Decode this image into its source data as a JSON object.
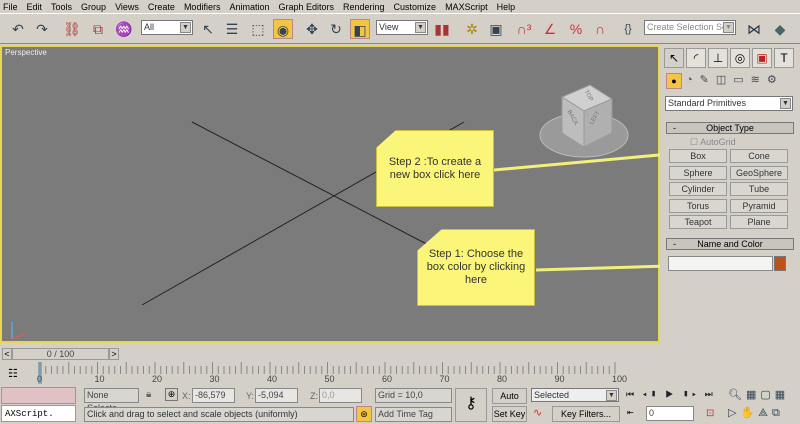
{
  "menu": [
    "File",
    "Edit",
    "Tools",
    "Group",
    "Views",
    "Create",
    "Modifiers",
    "Animation",
    "Graph Editors",
    "Rendering",
    "Customize",
    "MAXScript",
    "Help"
  ],
  "toolbar": {
    "filter_value": "All",
    "ref_coord_value": "View",
    "selection_set_placeholder": "Create Selection Set"
  },
  "viewport": {
    "label": "Perspective",
    "viewcube": {
      "top": "TOP",
      "back": "BACK",
      "left": "LEFT"
    }
  },
  "notes": {
    "step2": "Step 2 :To create a new box click here",
    "step1": "Step 1: Choose the box color by clicking here"
  },
  "panel": {
    "category_value": "Standard Primitives",
    "object_type_title": "Object Type",
    "autogrid_label": "AutoGrid",
    "buttons": [
      "Box",
      "Cone",
      "Sphere",
      "GeoSphere",
      "Cylinder",
      "Tube",
      "Torus",
      "Pyramid",
      "Teapot",
      "Plane"
    ],
    "name_color_title": "Name and Color",
    "name_value": "",
    "object_color": "#c0501a",
    "collapse_symbol": "-"
  },
  "timeline": {
    "frame_label": "0 / 100",
    "ticks": [
      "0",
      "10",
      "20",
      "30",
      "40",
      "50",
      "60",
      "70",
      "80",
      "90",
      "100"
    ],
    "prev": "<",
    "next": ">"
  },
  "status": {
    "maxscript": "AXScript.",
    "selection": "None Selecte",
    "x_label": "X:",
    "x_value": "-86,579",
    "y_label": "Y:",
    "y_value": "-5,094",
    "z_label": "Z:",
    "z_value": "0,0",
    "grid": "Grid = 10,0",
    "prompt": "Click and drag to select and scale objects (uniformly)",
    "add_time_tag": "Add Time Tag",
    "auto_key": "Auto Key",
    "set_key": "Set Key",
    "key_mode_value": "Selected",
    "key_filters": "Key Filters...",
    "current_frame": "0"
  }
}
